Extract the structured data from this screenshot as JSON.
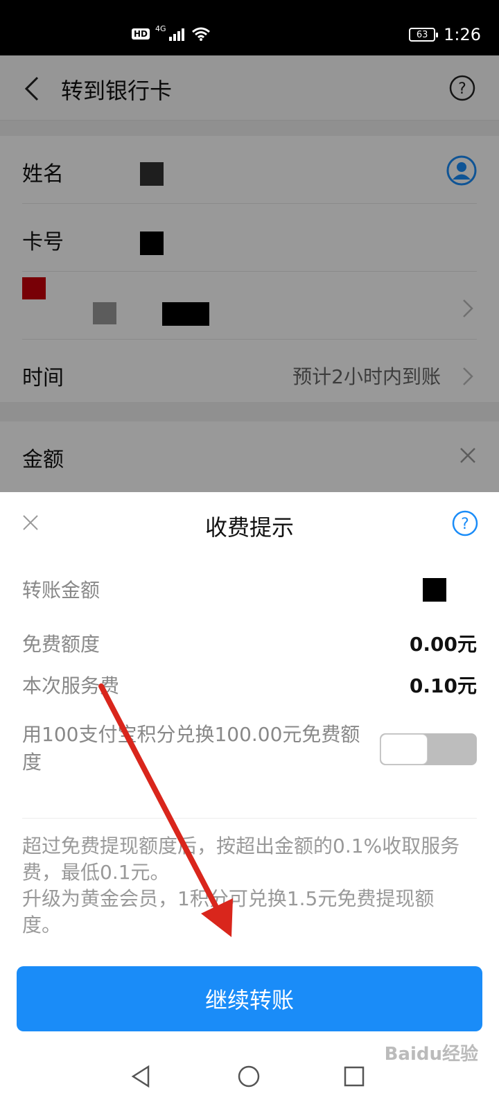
{
  "status_bar": {
    "time": "1:26",
    "battery": "63",
    "network": "4G",
    "hd": "HD"
  },
  "header": {
    "title": "转到银行卡"
  },
  "form": {
    "name_label": "姓名",
    "card_label": "卡号",
    "time_label": "时间",
    "time_value": "预计2小时内到账",
    "amount_label": "金额"
  },
  "sheet": {
    "title": "收费提示",
    "rows": [
      {
        "label": "转账金额",
        "value": ""
      },
      {
        "label": "免费额度",
        "value": "0.00元"
      },
      {
        "label": "本次服务费",
        "value": "0.10元"
      }
    ],
    "exchange_text": "用100支付宝积分兑换100.00元免费额度",
    "note_line1": "超过免费提现额度后，按超出金额的0.1%收取服务费，最低0.1元。",
    "note_line2": "升级为黄金会员，1积分可兑换1.5元免费提现额度。",
    "button_label": "继续转账"
  },
  "watermark": "Baidu经验",
  "colors": {
    "primary": "#1a8cf8",
    "annotation": "#d9261c"
  },
  "icons": [
    "back-icon",
    "help-icon",
    "contact-icon",
    "chevron-right-icon",
    "close-icon"
  ]
}
